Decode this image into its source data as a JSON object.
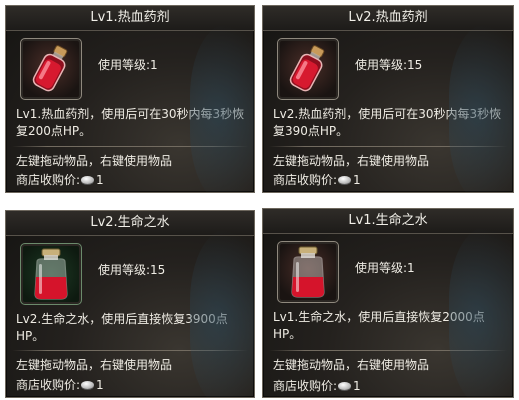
{
  "tooltips": [
    {
      "title": "Lv1.热血药剂",
      "level_text": "使用等级:1",
      "description": "Lv1.热血药剂，使用后可在30秒内每3秒恢复200点HP。",
      "hint": "左键拖动物品，右键使用物品",
      "price_label": "商店收购价:",
      "price_value": "1",
      "icon": "red-potion-vial-icon"
    },
    {
      "title": "Lv2.热血药剂",
      "level_text": "使用等级:15",
      "description": "Lv2.热血药剂，使用后可在30秒内每3秒恢复390点HP。",
      "hint": "左键拖动物品，右键使用物品",
      "price_label": "商店收购价:",
      "price_value": "1",
      "icon": "red-potion-vial-icon"
    },
    {
      "title": "Lv2.生命之水",
      "level_text": "使用等级:15",
      "description": "Lv2.生命之水，使用后直接恢复3900点HP。",
      "hint": "左键拖动物品，右键使用物品",
      "price_label": "商店收购价:",
      "price_value": "1",
      "icon": "water-of-life-bottle-icon"
    },
    {
      "title": "Lv1.生命之水",
      "level_text": "使用等级:1",
      "description": "Lv1.生命之水，使用后直接恢复2000点HP。",
      "hint": "左键拖动物品，右键使用物品",
      "price_label": "商店收购价:",
      "price_value": "1",
      "icon": "water-of-life-bottle-icon"
    }
  ],
  "colors": {
    "text": "#efece4",
    "potion_red": "#c8102e",
    "panel_border": "#6d675d"
  }
}
